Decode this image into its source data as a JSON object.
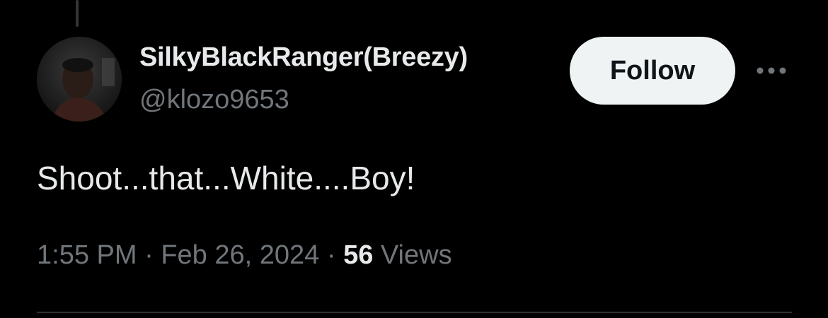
{
  "author": {
    "display_name": "SilkyBlackRanger(Breezy)",
    "handle": "@klozo9653",
    "avatar_icon": "user-avatar-photo"
  },
  "actions": {
    "follow_label": "Follow",
    "more_icon": "more-horizontal-icon"
  },
  "tweet": {
    "text": "Shoot...that...White....Boy!"
  },
  "meta": {
    "time": "1:55 PM",
    "separator": " · ",
    "date": "Feb 26, 2024",
    "views_count": "56",
    "views_label": " Views"
  },
  "colors": {
    "background": "#000000",
    "primary_text": "#e7e9ea",
    "secondary_text": "#71767b",
    "follow_bg": "#eff3f4",
    "follow_text": "#0f1419",
    "divider": "#2f3336"
  }
}
